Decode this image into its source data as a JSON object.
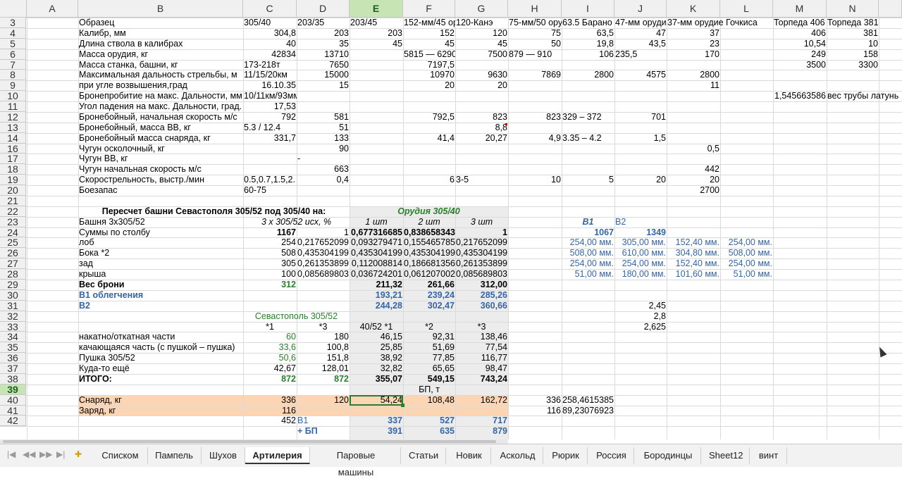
{
  "columns": [
    "A",
    "B",
    "C",
    "D",
    "E",
    "F",
    "G",
    "H",
    "I",
    "J",
    "K",
    "L",
    "M",
    "N"
  ],
  "selected_column": "E",
  "rows": [
    "3",
    "4",
    "5",
    "6",
    "7",
    "8",
    "9",
    "10",
    "11",
    "12",
    "13",
    "14",
    "16",
    "17",
    "18",
    "19",
    "20",
    "21",
    "22",
    "23",
    "24",
    "25",
    "26",
    "27",
    "28",
    "29",
    "30",
    "31",
    "32",
    "33",
    "34",
    "35",
    "36",
    "37",
    "38",
    "39",
    "40",
    "41",
    "42"
  ],
  "selected_row": "39",
  "cells": {
    "r3": {
      "B": "Образец",
      "C": "305/40",
      "D": "203/35",
      "E": "203/45",
      "F": "152-мм/45 ор",
      "G": "120-Канэ",
      "H": "75-мм/50 ору",
      "I": "63.5 Барано",
      "J": "47-мм орудие",
      "K": "37-мм орудие Гочкиса",
      "M": "Торпеда 406",
      "N": "Торпеда 381"
    },
    "r4": {
      "B": "Калибр, мм",
      "C": "304,8",
      "D": "203",
      "E": "203",
      "F": "152",
      "G": "120",
      "H": "75",
      "I": "63,5",
      "J": "47",
      "K": "37",
      "M": "406",
      "N": "381"
    },
    "r5": {
      "B": "Длина ствола в калибрах",
      "C": "40",
      "D": "35",
      "E": "45",
      "F": "45",
      "G": "45",
      "H": "50",
      "I": "19,8",
      "J": "43,5",
      "K": "23",
      "M": "10,54",
      "N": "10"
    },
    "r6": {
      "B": "Масса орудия, кг",
      "C": "42834",
      "D": "13710",
      "F": "5815 — 6290",
      "G": "7500",
      "H": "879 — 910",
      "I": "106",
      "J": "235,5",
      "K": "170",
      "M": "249",
      "N": "158"
    },
    "r7": {
      "B": "Масса станка, башни, кг",
      "C": "173-218т",
      "D": "7650",
      "F": "7197,5",
      "M": "3500",
      "N": "3300"
    },
    "r8": {
      "B": "Максимальная дальность стрельбы, м",
      "C": "11/15/20км",
      "D": "15000",
      "F": "10970",
      "G": "9630",
      "H": "7869",
      "I": "2800",
      "J": "4575",
      "K": "2800"
    },
    "r9": {
      "B": "при угле возвышения,град",
      "C": "16.10.35",
      "D": "15",
      "F": "20",
      "G": "20",
      "K": "11"
    },
    "r10": {
      "B": "Бронепробитие на макс. Дальности, мм",
      "C": "10/11км/93мм",
      "M": "1,545663586",
      "N": "вес трубы латунь"
    },
    "r11": {
      "B": "Угол падения на макс. Дальности, град.",
      "C": "17,53"
    },
    "r12": {
      "B": "Бронебойный, начальная скорость м/с",
      "C": "792",
      "D": "581",
      "F": "792,5",
      "G": "823",
      "H": "823",
      "I": "329 – 372",
      "J": "701"
    },
    "r13": {
      "B": "Бронебойный, масса ВВ, кг",
      "C": "5.3 / 12.4",
      "D": "51",
      "G": "8,8"
    },
    "r14": {
      "B": "Бронебойный масса снаряда, кг",
      "C": "331,7",
      "D": "133",
      "F": "41,4",
      "G": "20,27",
      "H": "4,9",
      "I": "3.35 – 4.2",
      "J": "1,5"
    },
    "r16": {
      "B": "Чугун осколочный, кг",
      "D": "90",
      "K": "0,5"
    },
    "r17": {
      "B": "Чугун ВВ, кг",
      "D": "-"
    },
    "r18": {
      "B": "Чугун начальная скорость м/с",
      "D": "663",
      "K": "442"
    },
    "r19": {
      "B": "Скорострельность, выстр./мин",
      "C": "0.5,0.7,1.5,2.",
      "D": "0,4",
      "F": "6",
      "G": "3-5",
      "H": "10",
      "I": "5",
      "J": "20",
      "K": "20"
    },
    "r20": {
      "B": "Боезапас",
      "C": "60-75",
      "K": "2700"
    },
    "r21": {},
    "r22": {
      "B": "Пересчет башни Севастополя 305/52 под 305/40 на:",
      "EF": "Орудия 305/40"
    },
    "r23": {
      "B": "Башня 3х305/52",
      "CD": "3 x 305/52 исх, %",
      "E": "1 шт",
      "F": "2 шт",
      "G": "3 шт",
      "I": "В1",
      "J": "В2"
    },
    "r24": {
      "B": "Суммы по столбу",
      "C": "1167",
      "D": "1",
      "E": "0,677316685",
      "F": "0,838658343",
      "G": "1",
      "I": "1067",
      "J": "1349"
    },
    "r25": {
      "B": "лоб",
      "C": "254",
      "D": "0,217652099",
      "E": "0,093279471",
      "F": "0,155465785",
      "G": "0,217652099",
      "I": "254,00 мм.",
      "J": "305,00 мм.",
      "K": "152,40 мм.",
      "L": "254,00 мм."
    },
    "r26": {
      "B": "Бока *2",
      "C": "508",
      "D": "0,435304199",
      "E": "0,435304199",
      "F": "0,435304199",
      "G": "0,435304199",
      "I": "508,00 мм.",
      "J": "610,00 мм.",
      "K": "304,80 мм.",
      "L": "508,00 мм."
    },
    "r27": {
      "B": "зад",
      "C": "305",
      "D": "0,261353899",
      "E": "0,112008814",
      "F": "0,186681356",
      "G": "0,261353899",
      "I": "254,00 мм.",
      "J": "254,00 мм.",
      "K": "152,40 мм.",
      "L": "254,00 мм."
    },
    "r28": {
      "B": "крыша",
      "C": "100",
      "D": "0,085689803",
      "E": "0,036724201",
      "F": "0,061207002",
      "G": "0,085689803",
      "I": "51,00 мм.",
      "J": "180,00 мм.",
      "K": "101,60 мм.",
      "L": "51,00 мм."
    },
    "r29": {
      "B": "Вес брони",
      "C": "312",
      "E": "211,32",
      "F": "261,66",
      "G": "312,00"
    },
    "r30": {
      "B": "В1 облегчения",
      "E": "193,21",
      "F": "239,24",
      "G": "285,26"
    },
    "r31": {
      "B": "В2",
      "E": "244,28",
      "F": "302,47",
      "G": "360,66",
      "J": "2,45"
    },
    "r32": {
      "CD": "Севастополь 305/52",
      "J": "2,8"
    },
    "r33": {
      "C": "*1",
      "D": "*3",
      "E": "40/52 *1",
      "F": "*2",
      "G": "*3",
      "J": "2,625"
    },
    "r34": {
      "B": "накатно/откатная части",
      "C": "60",
      "D": "180",
      "E": "46,15",
      "F": "92,31",
      "G": "138,46"
    },
    "r35": {
      "B": "качающаяся часть (с пушкой – пушка)",
      "C": "33,6",
      "D": "100,8",
      "E": "25,85",
      "F": "51,69",
      "G": "77,54"
    },
    "r36": {
      "B": "Пушка 305/52",
      "C": "50,6",
      "D": "151,8",
      "E": "38,92",
      "F": "77,85",
      "G": "116,77"
    },
    "r37": {
      "B": "Куда-то ещё",
      "C": "42,67",
      "D": "128,01",
      "E": "32,82",
      "F": "65,65",
      "G": "98,47"
    },
    "r38": {
      "B": "ИТОГО:",
      "C": "872",
      "D": "872",
      "E": "355,07",
      "F": "549,15",
      "G": "743,24"
    },
    "r39": {
      "F": "БП, т"
    },
    "r40": {
      "B": "Снаряд, кг",
      "C": "336",
      "D": "120",
      "E": "54,24",
      "F": "108,48",
      "G": "162,72",
      "H": "336",
      "I": "258,4615385"
    },
    "r41": {
      "B": "Заряд, кг",
      "C": "116",
      "H": "116",
      "I": "89,23076923"
    },
    "r42": {
      "C": "452",
      "D": "В1",
      "E": "337",
      "F": "527",
      "G": "717"
    },
    "r43": {
      "D": "+ БП",
      "E": "391",
      "F": "635",
      "G": "879"
    }
  },
  "sheet_tabs": [
    "Списком",
    "Пампель",
    "Шухов",
    "Артилерия",
    "Паровые машины",
    "Статьи",
    "Новик",
    "Аскольд",
    "Рюрик",
    "Россия",
    "Бородинцы",
    "Sheet12",
    "винт"
  ],
  "active_tab": "Артилерия",
  "colors": {
    "selected_header": "#c6e4b4",
    "gray_block": "#ececec",
    "peach_row": "#fcd5b4",
    "blue_text": "#3465a4",
    "green_text": "#2a7f2a"
  }
}
